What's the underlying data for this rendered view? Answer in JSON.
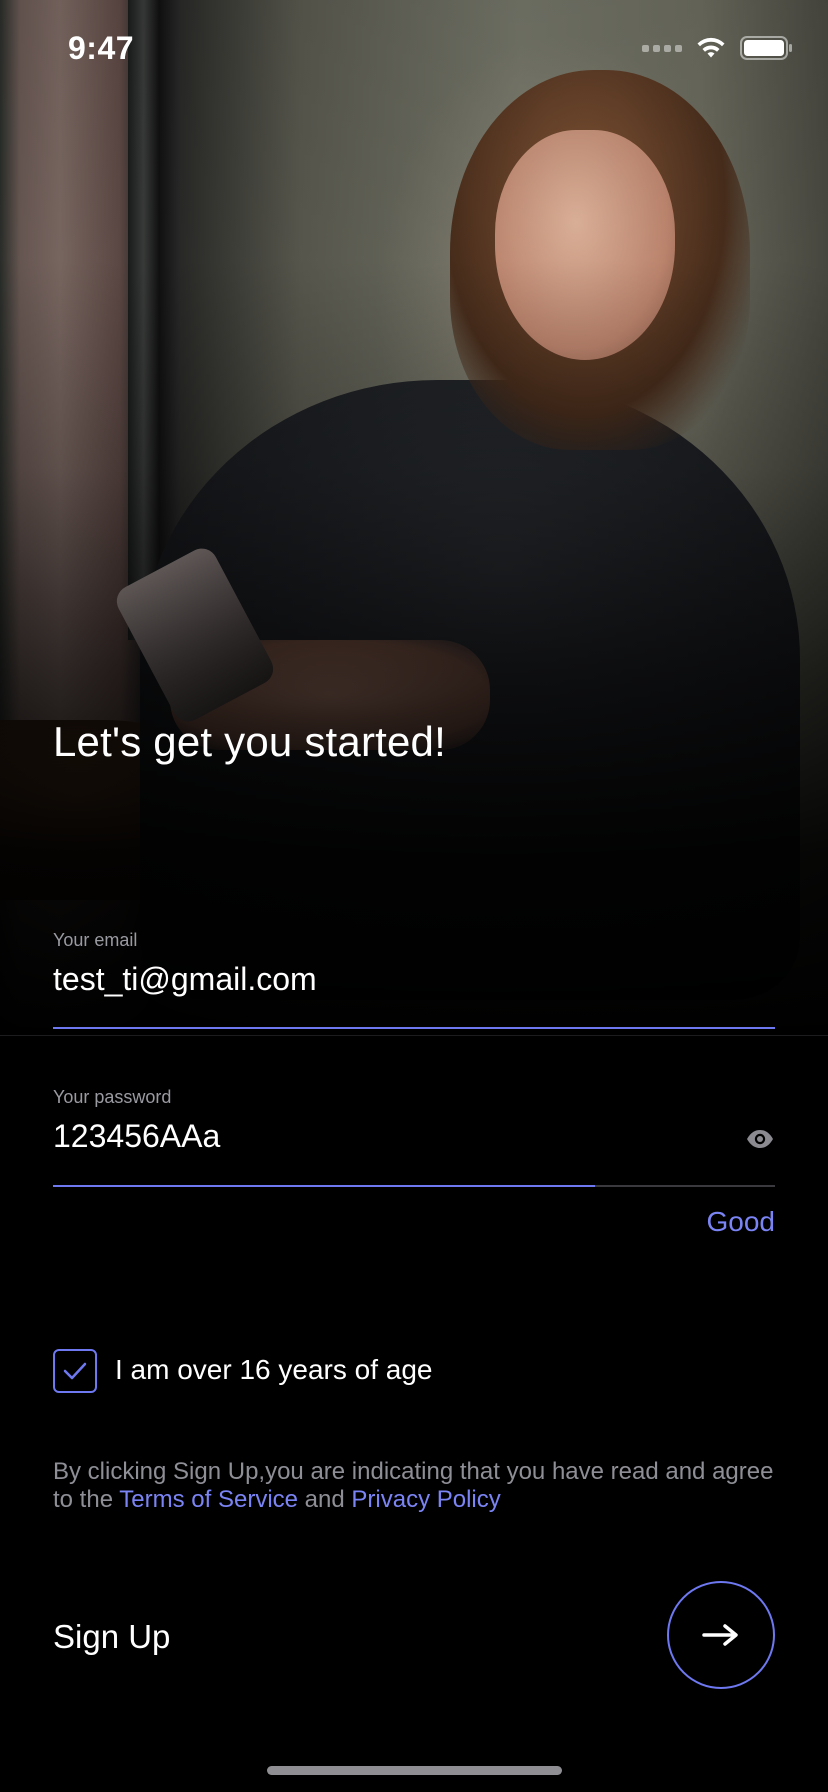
{
  "status_bar": {
    "time": "9:47"
  },
  "hero": {
    "title": "Let's get you started!"
  },
  "email": {
    "label": "Your email",
    "value": "test_ti@gmail.com"
  },
  "password": {
    "label": "Your password",
    "value": "123456AAa",
    "strength_label": "Good",
    "strength_fraction": 0.75
  },
  "age_check": {
    "label": "I am over 16 years of age",
    "checked": true
  },
  "legal": {
    "prefix": "By clicking Sign Up,you are indicating that you have read and agree to the",
    "terms_link": "Terms of Service",
    "conjunction": "and",
    "privacy_link": "Privacy Policy"
  },
  "footer": {
    "signup_label": "Sign Up"
  },
  "colors": {
    "accent": "#6e78f0",
    "link": "#7b84f4",
    "background": "#000000"
  },
  "icons": {
    "visibility": "eye-icon",
    "submit": "arrow-right-icon",
    "check": "checkmark-icon"
  }
}
